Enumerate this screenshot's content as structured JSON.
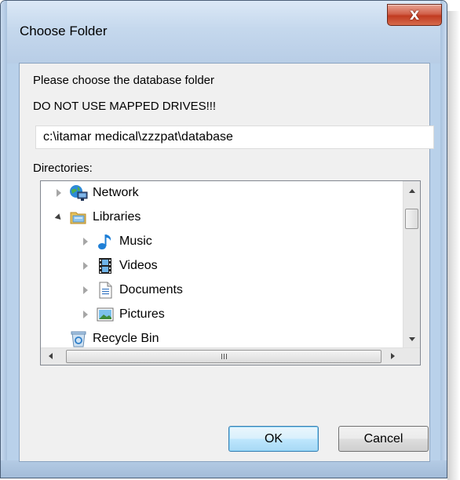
{
  "window": {
    "title": "Choose Folder",
    "close_glyph": "X"
  },
  "dialog": {
    "prompt": "Please choose the database folder",
    "warning": "DO NOT USE MAPPED DRIVES!!!",
    "path_value": "c:\\itamar medical\\zzzpat\\database",
    "directories_label": "Directories:"
  },
  "tree": {
    "items": [
      {
        "label": "Network",
        "icon": "network-icon",
        "level": 0,
        "expanded": false
      },
      {
        "label": "Libraries",
        "icon": "libraries-folder-icon",
        "level": 0,
        "expanded": true
      },
      {
        "label": "Music",
        "icon": "music-note-icon",
        "level": 1,
        "expanded": false
      },
      {
        "label": "Videos",
        "icon": "film-strip-icon",
        "level": 1,
        "expanded": false
      },
      {
        "label": "Documents",
        "icon": "document-icon",
        "level": 1,
        "expanded": false
      },
      {
        "label": "Pictures",
        "icon": "picture-icon",
        "level": 1,
        "expanded": false
      },
      {
        "label": "Recycle Bin",
        "icon": "recycle-bin-icon",
        "level": 0,
        "expanded": null
      }
    ],
    "hscroll_grip": "III"
  },
  "buttons": {
    "ok": "OK",
    "cancel": "Cancel"
  },
  "colors": {
    "frame": "#b9d1ea",
    "client_bg": "#f0f0f0",
    "close_red": "#c13b21",
    "default_button_border": "#3c7fb1"
  }
}
